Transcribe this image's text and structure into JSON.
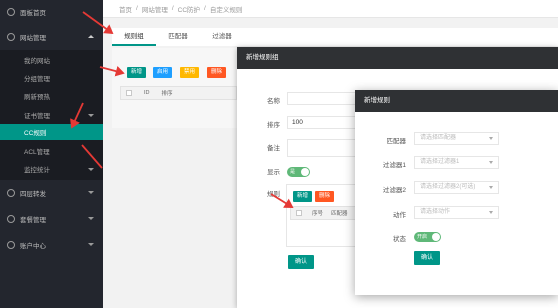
{
  "sidebar": {
    "items": [
      {
        "label": "面板首页"
      },
      {
        "label": "网站管理"
      },
      {
        "label": "四层转发"
      },
      {
        "label": "套餐管理"
      },
      {
        "label": "账户中心"
      }
    ],
    "sub_items": [
      {
        "label": "我的网站"
      },
      {
        "label": "分组管理"
      },
      {
        "label": "刷新预热"
      },
      {
        "label": "证书管理"
      },
      {
        "label": "CC规则"
      },
      {
        "label": "ACL管理"
      },
      {
        "label": "监控统计"
      }
    ]
  },
  "breadcrumb": [
    "首页",
    "/",
    "网站管理",
    "/",
    "CC防护",
    "/",
    "自定义规则"
  ],
  "tabs": [
    {
      "label": "规则组"
    },
    {
      "label": "匹配器"
    },
    {
      "label": "过滤器"
    }
  ],
  "toolbar": {
    "add": "新增",
    "enable": "启用",
    "disable": "禁用",
    "delete": "删除"
  },
  "table": {
    "columns": [
      "ID",
      "排序"
    ]
  },
  "dialog1": {
    "title": "新增规则组",
    "name_label": "名称",
    "sort_label": "排序",
    "sort_value": "100",
    "remark_label": "备注",
    "show_label": "显示",
    "show_toggle": "是",
    "rules_label": "规则",
    "rules_add": "新增",
    "rules_delete": "删除",
    "rules_columns": [
      "序号",
      "匹配器"
    ],
    "confirm": "确认"
  },
  "dialog2": {
    "title": "新增规则",
    "matcher_label": "匹配器",
    "matcher_placeholder": "请选择匹配器",
    "filter1_label": "过滤器1",
    "filter1_placeholder": "请选择过滤器1",
    "filter2_label": "过滤器2",
    "filter2_placeholder": "请选择过滤器2(可选)",
    "action_label": "动作",
    "action_placeholder": "请选择动作",
    "status_label": "状态",
    "status_toggle": "开启",
    "confirm": "确认"
  },
  "colors": {
    "sidebar_bg": "#23262e",
    "accent": "#009688",
    "dialog_header": "#2f3134",
    "arrow": "#e53935"
  }
}
